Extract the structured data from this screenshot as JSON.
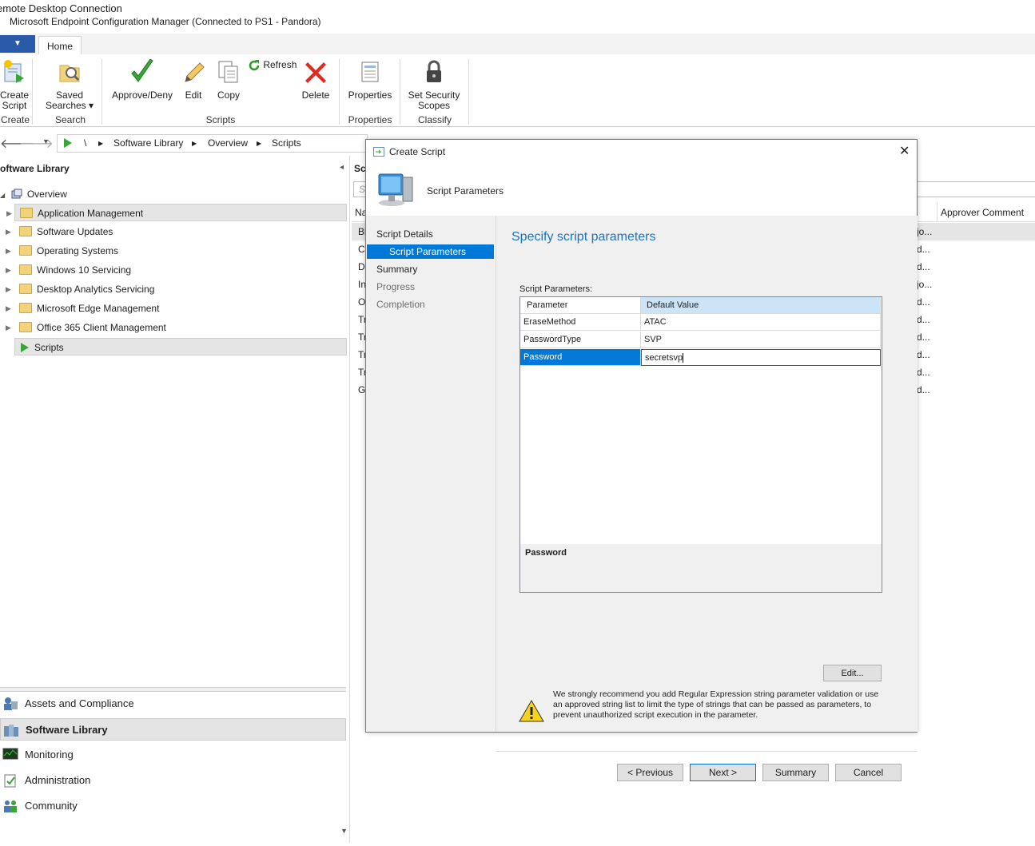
{
  "window": {
    "rdc_title": "emote Desktop Connection",
    "app_title": "Microsoft Endpoint Configuration Manager (Connected to PS1 - Pandora)"
  },
  "ribbon": {
    "tab_home": "Home",
    "buttons": {
      "create_script_1": "Create",
      "create_script_2": "Script",
      "saved_searches_1": "Saved",
      "saved_searches_2": "Searches ▾",
      "approve_deny": "Approve/Deny",
      "edit": "Edit",
      "copy": "Copy",
      "refresh": "Refresh",
      "delete": "Delete",
      "properties": "Properties",
      "set_security_1": "Set Security",
      "set_security_2": "Scopes"
    },
    "groups": {
      "create": "Create",
      "search": "Search",
      "scripts": "Scripts",
      "properties": "Properties",
      "classify": "Classify"
    }
  },
  "address": {
    "root": "\\",
    "crumbs": [
      "Software Library",
      "Overview",
      "Scripts"
    ]
  },
  "left_pane": {
    "title": "oftware Library",
    "overview": "Overview",
    "items": [
      "Application Management",
      "Software Updates",
      "Operating Systems",
      "Windows 10 Servicing",
      "Desktop Analytics Servicing",
      "Microsoft Edge Management",
      "Office 365 Client Management",
      "Scripts"
    ],
    "workspaces": [
      "Assets and Compliance",
      "Software Library",
      "Monitoring",
      "Administration",
      "Community"
    ]
  },
  "right_list": {
    "header_partial": "Scr",
    "search_partial": "Se",
    "col_name_partial": "Na",
    "col_approver_comment": "Approver Comment",
    "row_initials": [
      "Bl",
      "Cl",
      "D",
      "In",
      "O",
      "Tr",
      "Tr",
      "Tr",
      "Tr",
      "G"
    ],
    "row_approver": [
      "jo...",
      "d...",
      "d...",
      "jo...",
      "d...",
      "d...",
      "d...",
      "d...",
      "d...",
      "d..."
    ]
  },
  "dialog": {
    "title": "Create Script",
    "header": "Script Parameters",
    "nav": {
      "script_details": "Script Details",
      "script_parameters": "Script Parameters",
      "summary": "Summary",
      "progress": "Progress",
      "completion": "Completion"
    },
    "heading": "Specify script parameters",
    "params_label": "Script Parameters:",
    "grid": {
      "col_parameter": "Parameter",
      "col_default": "Default Value",
      "rows": [
        {
          "name": "EraseMethod",
          "value": "ATAC"
        },
        {
          "name": "PasswordType",
          "value": "SVP"
        },
        {
          "name": "Password",
          "value": "secretsvp"
        }
      ],
      "detail_title": "Password"
    },
    "edit_button": "Edit...",
    "warning": "We strongly recommend you add Regular Expression string parameter validation or use an approved string list to limit the type of strings that can be passed as parameters, to prevent unauthorized script execution in the parameter.",
    "buttons": {
      "previous": "< Previous",
      "next": "Next >",
      "summary": "Summary",
      "cancel": "Cancel"
    }
  },
  "colors": {
    "accent": "#0078d7",
    "heading": "#1e73be",
    "panel": "#f0f0f0"
  }
}
